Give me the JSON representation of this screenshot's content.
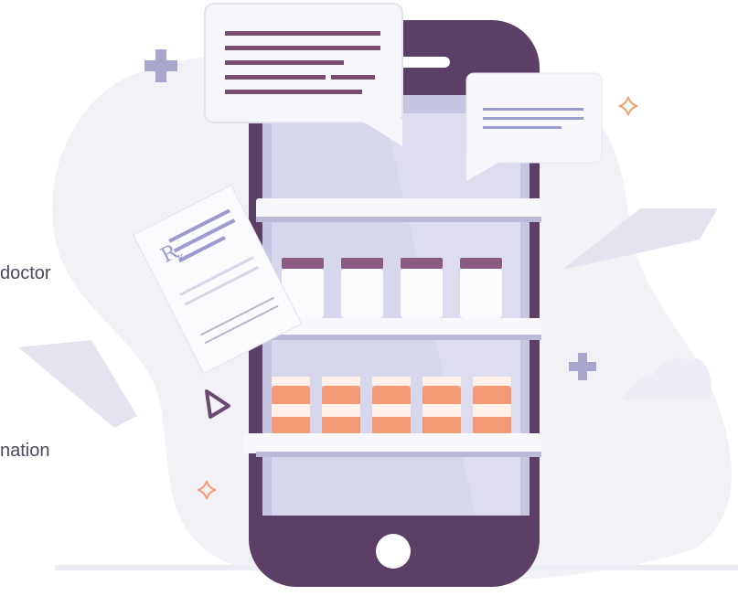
{
  "text_fragments": [
    {
      "id": "fragment-1",
      "text": "doctor"
    },
    {
      "id": "fragment-2",
      "text": "nation"
    }
  ],
  "illustration": {
    "subject": "phone-pharmacy",
    "prescription_mark": "Rx",
    "icons": [
      "plus-icon",
      "plus-icon",
      "sparkle-icon",
      "sparkle-icon",
      "triangle-icon",
      "cloud-icon",
      "paper-plane-icon",
      "paper-plane-icon",
      "chat-bubble-icon",
      "chat-bubble-icon",
      "home-button-icon"
    ],
    "shelves": {
      "rows": 2,
      "upper_jars": 4,
      "lower_jars": 5
    },
    "colors": {
      "phone_body": "#5c3f66",
      "screen": "#c6c6e2",
      "screen_inner": "#d6d6ec",
      "shelf": "#f8f8fc",
      "jar_lid_purple": "#8b5a82",
      "jar_orange": "#f29a76",
      "jar_cream": "#fff1e7",
      "blob": "#f1f1f6",
      "accent_plus": "#a8a6cc",
      "accent_star": "#f3a070",
      "bubble": "#f6f6fb",
      "bubble_lines_dark": "#7a4d70",
      "bubble_lines_light": "#9b9bd0",
      "text": "#4a4a5a"
    }
  }
}
